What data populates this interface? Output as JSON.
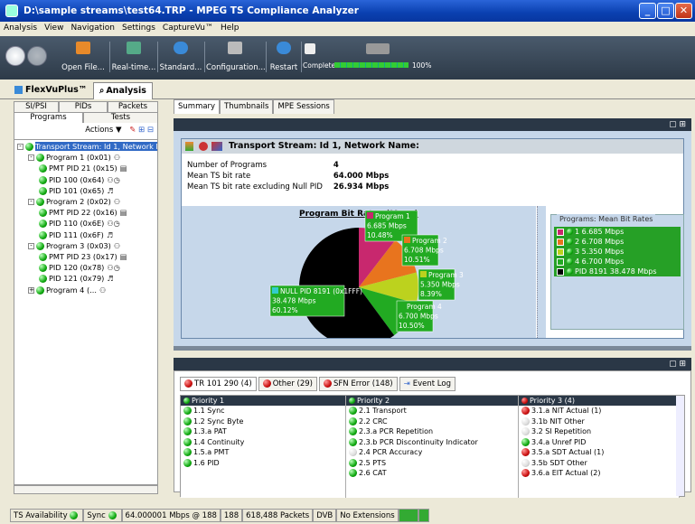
{
  "window": {
    "title": "D:\\sample streams\\test64.TRP - MPEG TS Compliance Analyzer"
  },
  "menu": [
    "Analysis",
    "View",
    "Navigation",
    "Settings",
    "CaptureVu™",
    "Help"
  ],
  "toolbar": {
    "open_file": "Open File...",
    "realtime": "Real-time...",
    "standard": "Standard...",
    "configuration": "Configuration...",
    "restart": "Restart",
    "complete": "Complete",
    "progress_value": "100%",
    "progress_fraction": 1.0
  },
  "top_tabs": [
    "FlexVuPlus™",
    "Analysis"
  ],
  "left": {
    "tabs_row1": [
      "SI/PSI",
      "PIDs",
      "Packets"
    ],
    "tabs_row2": [
      "Programs",
      "Tests"
    ],
    "actions": "Actions ▼",
    "tree": [
      {
        "label": "Transport Stream: Id 1, Network N",
        "icon": "green",
        "level": 0,
        "sel": true,
        "exp": "-"
      },
      {
        "label": "Program 1 (0x01)",
        "icon": "green",
        "level": 1,
        "exp": "-",
        "extra": "⚇"
      },
      {
        "label": "PMT PID 21 (0x15)",
        "icon": "green",
        "level": 2,
        "extra": "▤"
      },
      {
        "label": "PID 100 (0x64)",
        "icon": "green",
        "level": 2,
        "extra": "⚇◷"
      },
      {
        "label": "PID 101 (0x65)",
        "icon": "green",
        "level": 2,
        "extra": "♬"
      },
      {
        "label": "Program 2 (0x02)",
        "icon": "green",
        "level": 1,
        "exp": "-",
        "extra": "⚇"
      },
      {
        "label": "PMT PID 22 (0x16)",
        "icon": "green",
        "level": 2,
        "extra": "▤"
      },
      {
        "label": "PID 110 (0x6E)",
        "icon": "green",
        "level": 2,
        "extra": "⚇◷"
      },
      {
        "label": "PID 111 (0x6F)",
        "icon": "green",
        "level": 2,
        "extra": "♬"
      },
      {
        "label": "Program 3 (0x03)",
        "icon": "green",
        "level": 1,
        "exp": "-",
        "extra": "⚇"
      },
      {
        "label": "PMT PID 23 (0x17)",
        "icon": "green",
        "level": 2,
        "extra": "▤"
      },
      {
        "label": "PID 120 (0x78)",
        "icon": "green",
        "level": 2,
        "extra": "⚇◷"
      },
      {
        "label": "PID 121 (0x79)",
        "icon": "green",
        "level": 2,
        "extra": "♬"
      },
      {
        "label": "Program 4 (...",
        "icon": "green",
        "level": 1,
        "exp": "+",
        "extra": "⚇"
      }
    ]
  },
  "summary": {
    "tabs": [
      "Summary",
      "Thumbnails",
      "MPE Sessions"
    ],
    "header": "Transport Stream: Id 1, Network Name:",
    "info": [
      [
        "Number of Programs",
        "4"
      ],
      [
        "Mean TS bit rate",
        "64.000 Mbps"
      ],
      [
        "Mean TS bit rate excluding Null PID",
        "26.934 Mbps"
      ]
    ],
    "chart_title": "Program Bit Rates (Mean)",
    "legend_title": "Programs: Mean Bit Rates",
    "legend": [
      {
        "swatch": "#c8286e",
        "label": "1   6.685 Mbps"
      },
      {
        "swatch": "#e8741e",
        "label": "2   6.708 Mbps"
      },
      {
        "swatch": "#bcd21e",
        "label": "3   5.350 Mbps"
      },
      {
        "swatch": "#22aa22",
        "label": "4   6.700 Mbps"
      },
      {
        "swatch": "#000000",
        "label": "PID 8191 38.478 Mbps"
      }
    ]
  },
  "chart_data": {
    "type": "pie",
    "title": "Program Bit Rates (Mean)",
    "slices": [
      {
        "name": "Program 1",
        "value_mbps": 6.685,
        "percent": 10.48,
        "color": "#c8286e",
        "label": [
          "Program 1",
          "6.685 Mbps",
          "10.48%"
        ]
      },
      {
        "name": "Program 2",
        "value_mbps": 6.708,
        "percent": 10.51,
        "color": "#e8741e",
        "label": [
          "Program 2",
          "6.708 Mbps",
          "10.51%"
        ]
      },
      {
        "name": "Program 3",
        "value_mbps": 5.35,
        "percent": 8.39,
        "color": "#bcd21e",
        "label": [
          "Program 3",
          "5.350 Mbps",
          "8.39%"
        ]
      },
      {
        "name": "Program 4",
        "value_mbps": 6.7,
        "percent": 10.5,
        "color": "#22aa22",
        "label": [
          "Program 4",
          "6.700 Mbps",
          "10.50%"
        ]
      },
      {
        "name": "NULL PID 8191 (0x1FFF)",
        "value_mbps": 38.478,
        "percent": 60.12,
        "color": "#000000",
        "label": [
          "NULL PID 8191 (0x1FFF)",
          "38.478 Mbps",
          "60.12%"
        ]
      }
    ]
  },
  "bottom": {
    "tabs": [
      "TR 101 290 (4)",
      "Other (29)",
      "SFN Error (148)",
      "Event Log"
    ],
    "columns": [
      {
        "header": "Priority 1",
        "items": [
          [
            "1.1 Sync",
            "green"
          ],
          [
            "1.2 Sync Byte",
            "green"
          ],
          [
            "1.3.a PAT",
            "green"
          ],
          [
            "1.4 Continuity",
            "green"
          ],
          [
            "1.5.a PMT",
            "green"
          ],
          [
            "1.6 PID",
            "green"
          ]
        ]
      },
      {
        "header": "Priority 2",
        "items": [
          [
            "2.1 Transport",
            "green"
          ],
          [
            "2.2 CRC",
            "green"
          ],
          [
            "2.3.a PCR Repetition",
            "green"
          ],
          [
            "2.3.b PCR Discontinuity Indicator",
            "green"
          ],
          [
            "2.4 PCR Accuracy",
            "white"
          ],
          [
            "2.5 PTS",
            "green"
          ],
          [
            "2.6 CAT",
            "green"
          ]
        ]
      },
      {
        "header": "Priority 3 (4)",
        "items": [
          [
            "3.1.a NIT Actual (1)",
            "red"
          ],
          [
            "3.1b NIT Other",
            "white"
          ],
          [
            "3.2 SI Repetition",
            "white"
          ],
          [
            "3.4.a Unref PID",
            "green"
          ],
          [
            "3.5.a SDT Actual (1)",
            "red"
          ],
          [
            "3.5b SDT Other",
            "white"
          ],
          [
            "3.6.a EIT Actual (2)",
            "red"
          ]
        ]
      }
    ]
  },
  "status": [
    "TS Availability",
    "Sync",
    "64.000001 Mbps @ 188",
    "188",
    "618,488 Packets",
    "DVB",
    "No Extensions"
  ]
}
